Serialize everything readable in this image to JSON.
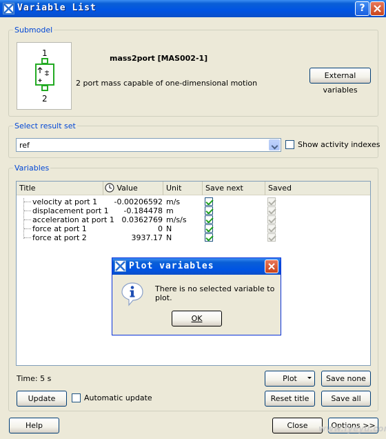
{
  "window": {
    "title": "Variable List"
  },
  "submodel": {
    "legend": "Submodel",
    "name": "mass2port [MAS002-1]",
    "description": "2 port mass capable of one-dimensional motion",
    "port_top": "1",
    "port_bottom": "2",
    "external_button": "External variables"
  },
  "result_set": {
    "legend": "Select result set",
    "selected": "ref",
    "show_activity_label": "Show activity indexes",
    "show_activity_checked": false
  },
  "variables": {
    "legend": "Variables",
    "columns": [
      "Title",
      "Value",
      "Unit",
      "Save next",
      "Saved"
    ],
    "rows": [
      {
        "title": "velocity at port 1",
        "value": "-0.00206592",
        "unit": "m/s",
        "save_next": true,
        "saved": true
      },
      {
        "title": "displacement port 1",
        "value": "-0.184478",
        "unit": "m",
        "save_next": true,
        "saved": true
      },
      {
        "title": "acceleration at port 1",
        "value": "0.0362769",
        "unit": "m/s/s",
        "save_next": true,
        "saved": true
      },
      {
        "title": "force at port 1",
        "value": "0",
        "unit": "N",
        "save_next": true,
        "saved": true
      },
      {
        "title": "force at port 2",
        "value": "3937.17",
        "unit": "N",
        "save_next": true,
        "saved": true
      }
    ],
    "time_label": "Time: 5 s",
    "plot_button": "Plot",
    "save_none_button": "Save none",
    "update_button": "Update",
    "automatic_update_label": "Automatic update",
    "automatic_update_checked": false,
    "reset_title_button": "Reset title",
    "save_all_button": "Save all"
  },
  "footer": {
    "help_button": "Help",
    "close_button": "Close",
    "options_button": "Options >>"
  },
  "dialog": {
    "title": "Plot variables",
    "message": "There is no selected variable to plot.",
    "ok_button": "OK",
    "icon": "info-icon"
  },
  "watermark": "www.fyeyu.com",
  "colors": {
    "accent": "#0054e3",
    "legend": "#0046d5",
    "check": "#21a121"
  }
}
